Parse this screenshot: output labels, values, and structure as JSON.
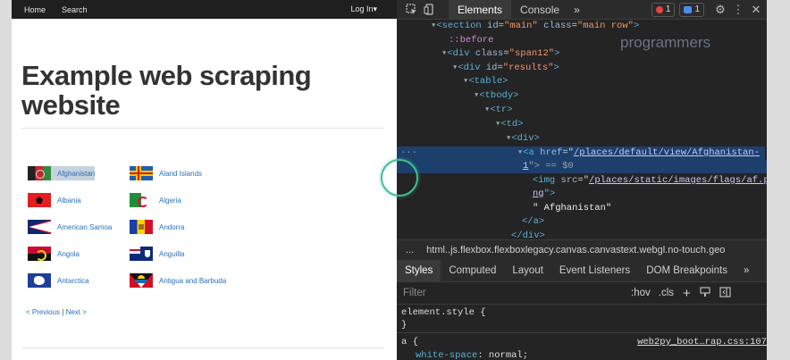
{
  "site": {
    "nav": {
      "home": "Home",
      "search": "Search",
      "login": "Log In",
      "login_caret": "▾"
    },
    "title": "Example web scraping website",
    "countries": [
      {
        "name": "Afghanistan",
        "flag": "afghanistan"
      },
      {
        "name": "Aland Islands",
        "flag": "aland"
      },
      {
        "name": "Albania",
        "flag": "albania"
      },
      {
        "name": "Algeria",
        "flag": "algeria"
      },
      {
        "name": "American Samoa",
        "flag": "american-samoa"
      },
      {
        "name": "Andorra",
        "flag": "andorra"
      },
      {
        "name": "Angola",
        "flag": "angola"
      },
      {
        "name": "Anguilla",
        "flag": "anguilla"
      },
      {
        "name": "Antarctica",
        "flag": "antarctica"
      },
      {
        "name": "Antigua and Barbuda",
        "flag": "antigua"
      }
    ],
    "pager": {
      "previous": "< Previous",
      "sep": "|",
      "next": "Next >"
    }
  },
  "devtools": {
    "tabs": {
      "elements": "Elements",
      "console": "Console",
      "more": "»"
    },
    "errors": "1",
    "messages": "1",
    "dom": {
      "l0_tag": "<section ",
      "l0_a1": "id",
      "l0_v1": "\"main\"",
      "l0_a2": "class",
      "l0_v2": "\"main row\"",
      "l0_end": ">",
      "l1": "::before",
      "l2_tag": "<div ",
      "l2_a": "class",
      "l2_v": "\"span12\"",
      "l2_end": ">",
      "l3_tag": "<div ",
      "l3_a": "id",
      "l3_v": "\"results\"",
      "l3_end": ">",
      "l4": "<table>",
      "l5": "<tbody>",
      "l6": "<tr>",
      "l7": "<td>",
      "l8": "<div>",
      "l9_tag": "<a ",
      "l9_a": "href",
      "l9_v": "/places/default/view/Afghanistan-",
      "l10_v": "1",
      "l10_rest": "\"> == $0",
      "l11_tag": "<img ",
      "l11_a": "src",
      "l11_v": "/places/static/images/flags/af.p",
      "l12_v": "ng",
      "l12_end": "\">",
      "l13": "\" Afghanistan\"",
      "l14": "</a>",
      "l15": "</div>"
    },
    "breadcrumb": "html..js.flexbox.flexboxlegacy.canvas.canvastext.webgl.no-touch.geo",
    "breadcrumb_ellipsis": "...",
    "subtabs": [
      "Styles",
      "Computed",
      "Layout",
      "Event Listeners",
      "DOM Breakpoints"
    ],
    "subtabs_more": "»",
    "filter": {
      "placeholder": "Filter",
      "hov": ":hov",
      "cls": ".cls",
      "plus": "+"
    },
    "styles": {
      "element_style": "element.style {",
      "close": "}",
      "a_selector": "a {",
      "a_source": "web2py_boot…rap.css:107",
      "prop": "white-space",
      "prop_val": "normal;"
    },
    "watermark": "programmers"
  },
  "colors": {
    "accent": "#2a6fb8",
    "selection": "#1d3f6b",
    "devtools_bg": "#242424"
  }
}
